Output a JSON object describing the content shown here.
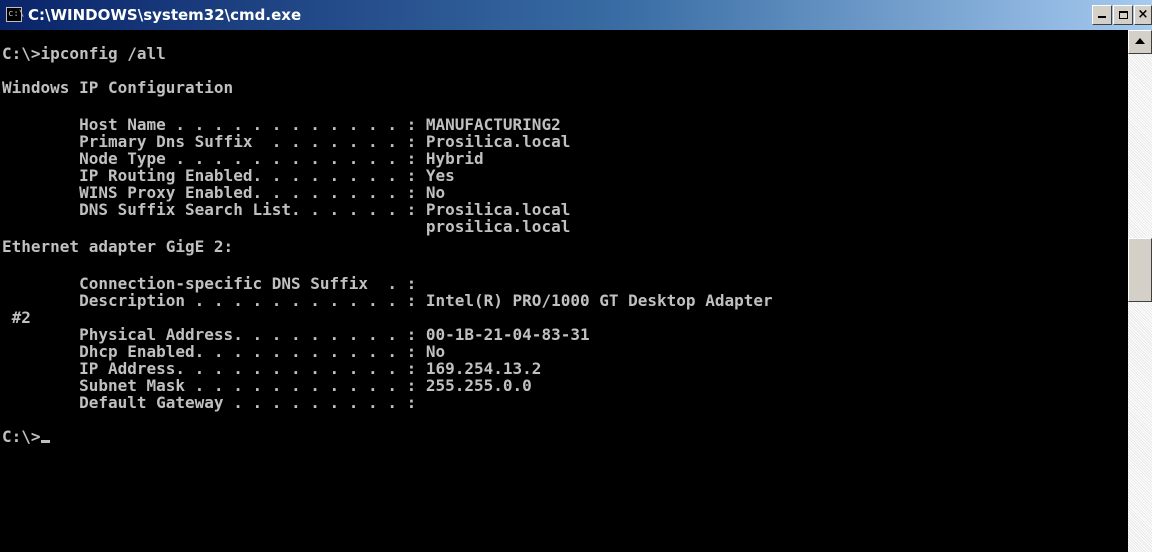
{
  "window": {
    "title": "C:\\WINDOWS\\system32\\cmd.exe",
    "icon_label": "c:\\",
    "buttons": {
      "minimize": "minimize",
      "maximize": "maximize",
      "close": "×"
    }
  },
  "console": {
    "lines": [
      "C:\\>ipconfig /all",
      "",
      "Windows IP Configuration",
      "",
      "        Host Name . . . . . . . . . . . . : MANUFACTURING2",
      "        Primary Dns Suffix  . . . . . . . : Prosilica.local",
      "        Node Type . . . . . . . . . . . . : Hybrid",
      "        IP Routing Enabled. . . . . . . . : Yes",
      "        WINS Proxy Enabled. . . . . . . . : No",
      "        DNS Suffix Search List. . . . . . : Prosilica.local",
      "                                            prosilica.local",
      "Ethernet adapter GigE 2:",
      "",
      "        Connection-specific DNS Suffix  . :",
      "        Description . . . . . . . . . . . : Intel(R) PRO/1000 GT Desktop Adapter",
      " #2",
      "        Physical Address. . . . . . . . . : 00-1B-21-04-83-31",
      "        Dhcp Enabled. . . . . . . . . . . : No",
      "        IP Address. . . . . . . . . . . . : 169.254.13.2",
      "        Subnet Mask . . . . . . . . . . . : 255.255.0.0",
      "        Default Gateway . . . . . . . . . :",
      "",
      "C:\\>"
    ]
  }
}
